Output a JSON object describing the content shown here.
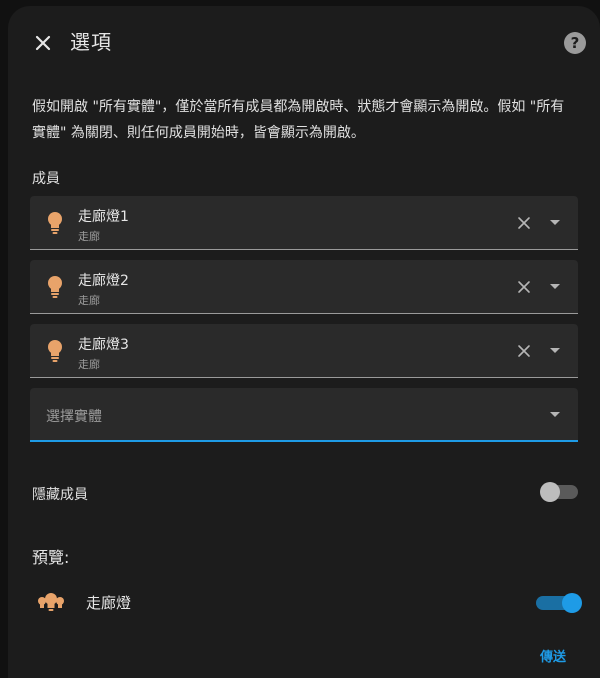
{
  "dialog": {
    "title": "選項",
    "description": "假如開啟 \"所有實體\"，僅於當所有成員都為開啟時、狀態才會顯示為開啟。假如 \"所有實體\" 為關閉、則任何成員開始時，皆會顯示為開啟。"
  },
  "members": {
    "label": "成員",
    "items": [
      {
        "name": "走廊燈1",
        "area": "走廊"
      },
      {
        "name": "走廊燈2",
        "area": "走廊"
      },
      {
        "name": "走廊燈3",
        "area": "走廊"
      }
    ],
    "select_placeholder": "選擇實體"
  },
  "hide_members": {
    "label": "隱藏成員",
    "value": false
  },
  "preview": {
    "label": "預覽:",
    "entity_name": "走廊燈",
    "state_on": true
  },
  "actions": {
    "submit_label": "傳送"
  },
  "colors": {
    "accent": "#1e9be6",
    "bulb": "#e8a36a",
    "surface": "#1c1c1c",
    "field": "#2a2a2a"
  },
  "icons": {
    "close": "close-icon",
    "help": "help-circle-icon",
    "bulb": "lightbulb-icon",
    "group": "lightbulb-group-icon"
  }
}
